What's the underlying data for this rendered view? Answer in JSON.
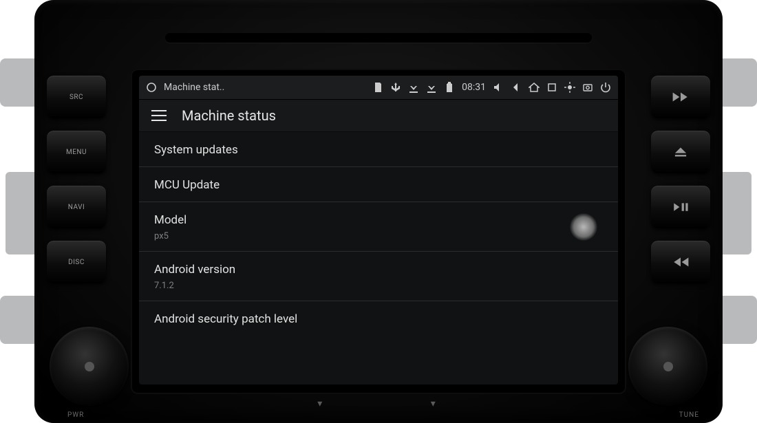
{
  "statusbar": {
    "title": "Machine stat..",
    "time": "08:31"
  },
  "header": {
    "title": "Machine status"
  },
  "rows": [
    {
      "primary": "System updates",
      "secondary": ""
    },
    {
      "primary": "MCU Update",
      "secondary": ""
    },
    {
      "primary": "Model",
      "secondary": "px5"
    },
    {
      "primary": "Android version",
      "secondary": "7.1.2"
    },
    {
      "primary": "Android security patch level",
      "secondary": ""
    }
  ],
  "hardware": {
    "left_buttons": [
      "SRC",
      "MENU",
      "NAVI",
      "DISC"
    ],
    "knob_left_label": "PWR",
    "knob_right_label": "TUNE"
  }
}
